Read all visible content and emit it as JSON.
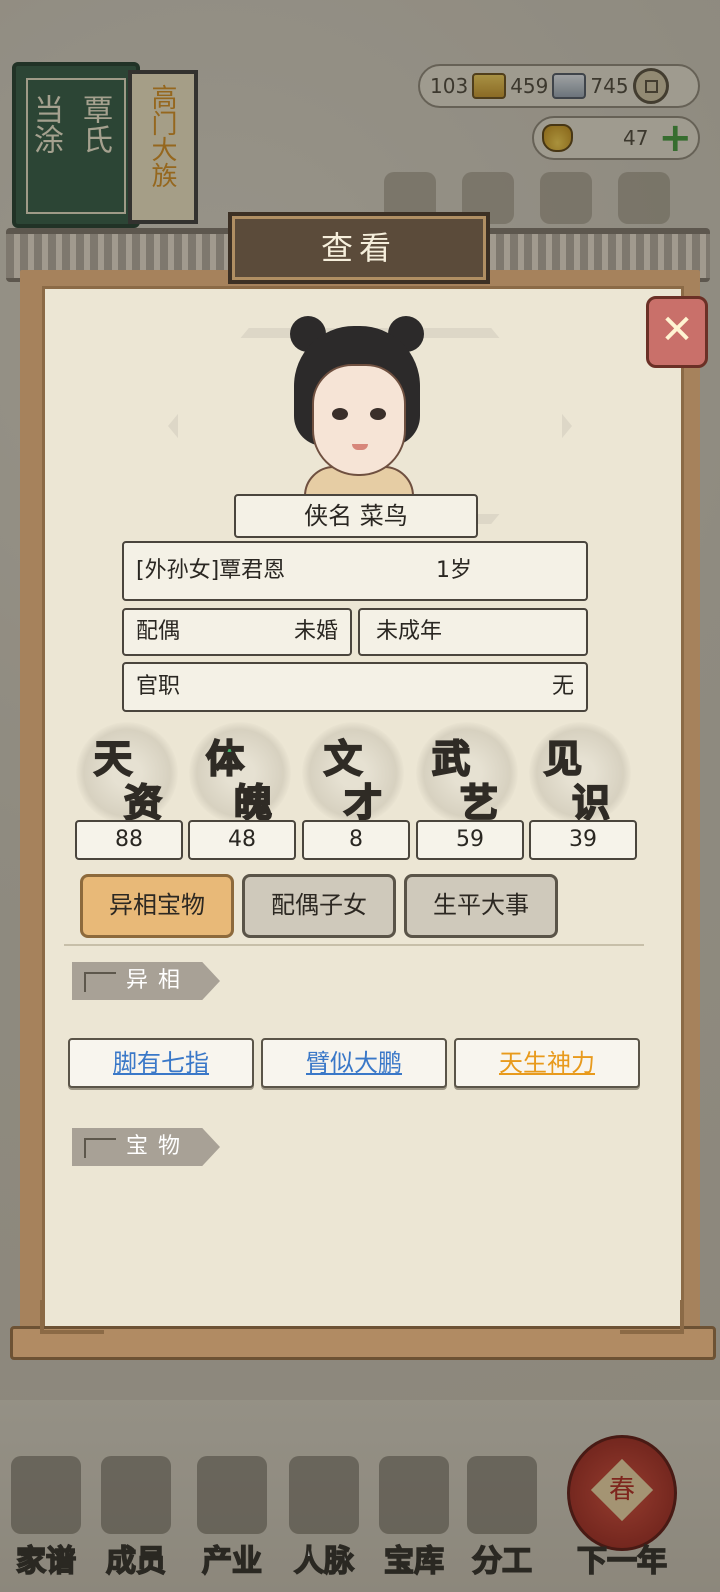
{
  "background": {
    "book_title_left": "当涂",
    "book_title_right": "覃氏",
    "scroll_tag": "高门大族",
    "resources": {
      "silver_small": "103",
      "gold_small": "459",
      "coins": "745",
      "ingots": "47"
    }
  },
  "modal": {
    "title": "查看",
    "close_label": "✕",
    "nickname": "侠名 菜鸟",
    "relation_name": "[外孙女]覃君恩",
    "age": "1岁",
    "spouse_label": "配偶",
    "spouse_value": "未婚",
    "adult_status": "未成年",
    "office_label": "官职",
    "office_value": "无",
    "stats": [
      {
        "label_top": "天",
        "label_bottom": "资",
        "value": "88",
        "color": "#3a7fd6"
      },
      {
        "label_top": "体",
        "label_bottom": "魄",
        "value": "48",
        "color": "#3fb56a"
      },
      {
        "label_top": "文",
        "label_bottom": "才",
        "value": "8",
        "color": "#b04bd6"
      },
      {
        "label_top": "武",
        "label_bottom": "艺",
        "value": "59",
        "color": "#e0a24a"
      },
      {
        "label_top": "见",
        "label_bottom": "识",
        "value": "39",
        "color": "#d6564e"
      }
    ],
    "tabs": [
      {
        "label": "异相宝物",
        "active": true
      },
      {
        "label": "配偶子女",
        "active": false
      },
      {
        "label": "生平大事",
        "active": false
      }
    ],
    "section_traits": "异相",
    "traits": [
      {
        "label": "脚有七指",
        "color": "#3a78c8"
      },
      {
        "label": "臂似大鹏",
        "color": "#3a78c8"
      },
      {
        "label": "天生神力",
        "color": "#e89a1c"
      }
    ],
    "section_treasures": "宝物"
  },
  "bottom_nav": [
    {
      "label": "家谱",
      "icon": "genealogy-book-icon"
    },
    {
      "label": "成员",
      "icon": "member-icon"
    },
    {
      "label": "产业",
      "icon": "property-icon"
    },
    {
      "label": "人脉",
      "icon": "network-icon"
    },
    {
      "label": "宝库",
      "icon": "treasury-icon"
    },
    {
      "label": "分工",
      "icon": "division-icon"
    },
    {
      "label": "下一年",
      "icon": "next-year-lantern-icon"
    }
  ],
  "lantern_char": "春"
}
